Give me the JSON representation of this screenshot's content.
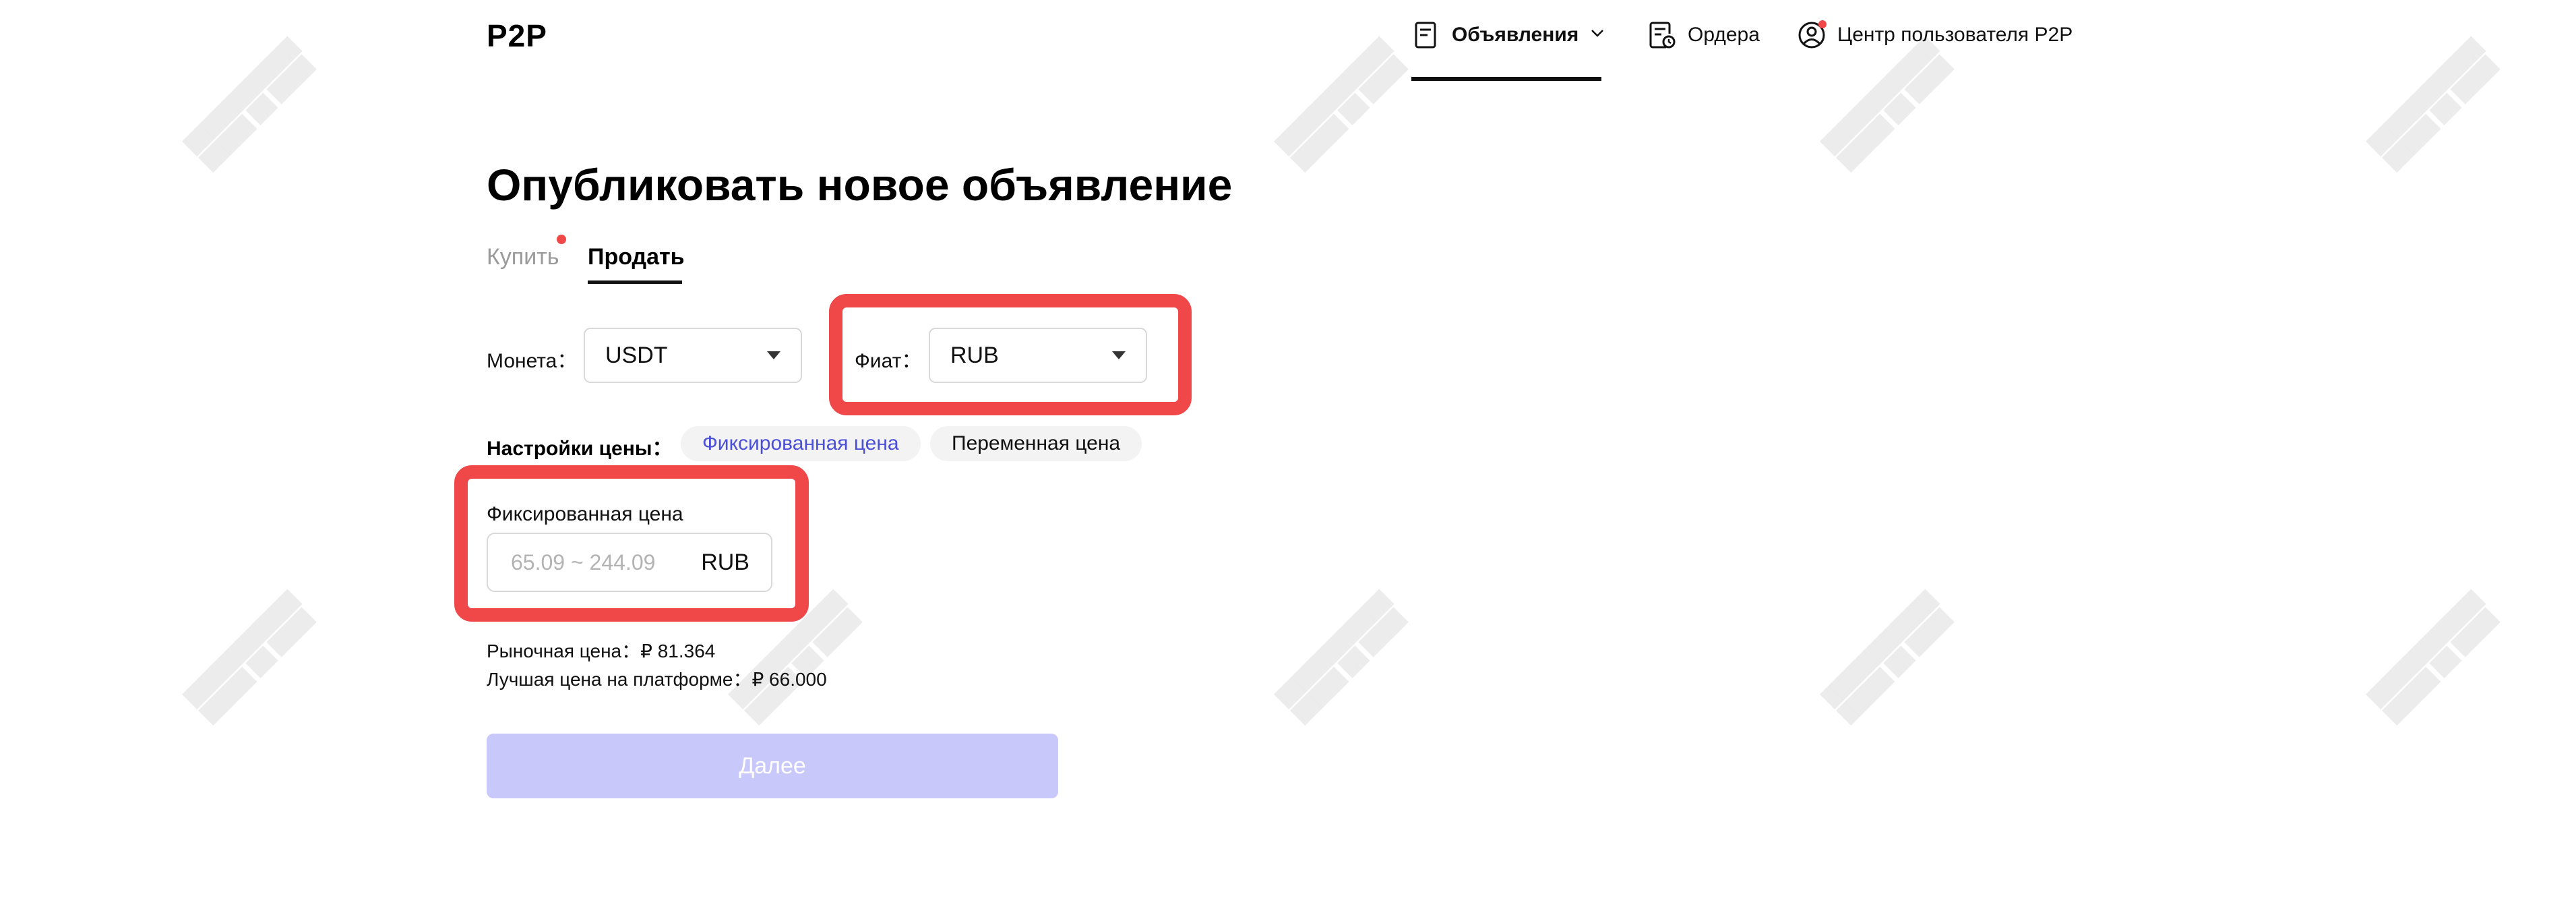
{
  "header": {
    "logo": "P2P",
    "nav": [
      {
        "label": "Объявления",
        "icon": "document-icon",
        "active": true,
        "has_dropdown": true
      },
      {
        "label": "Ордера",
        "icon": "order-clock-icon",
        "active": false
      },
      {
        "label": "Центр пользователя P2P",
        "icon": "user-circle-icon",
        "active": false,
        "notification_dot": true
      }
    ]
  },
  "page": {
    "title": "Опубликовать новое объявление",
    "tabs": [
      {
        "label": "Купить",
        "active": false,
        "notification_dot": true
      },
      {
        "label": "Продать",
        "active": true
      }
    ]
  },
  "form": {
    "coin_label": "Монета：",
    "coin_value": "USDT",
    "fiat_label": "Фиат：",
    "fiat_value": "RUB",
    "price_settings_label": "Настройки цены：",
    "price_types": [
      {
        "label": "Фиксированная цена",
        "selected": true
      },
      {
        "label": "Переменная цена",
        "selected": false
      }
    ],
    "fixed_price_label": "Фиксированная цена",
    "fixed_price_placeholder": "65.09 ~ 244.09",
    "fixed_price_unit": "RUB",
    "market_price_text": "Рыночная цена：₽ 81.364",
    "best_price_text": "Лучшая цена на платформе：₽ 66.000",
    "next_button": "Далее"
  },
  "colors": {
    "accent": "#4b4fd6",
    "button_disabled_bg": "#c9c8fb",
    "highlight": "#f04848",
    "notification_dot": "#f04848"
  }
}
